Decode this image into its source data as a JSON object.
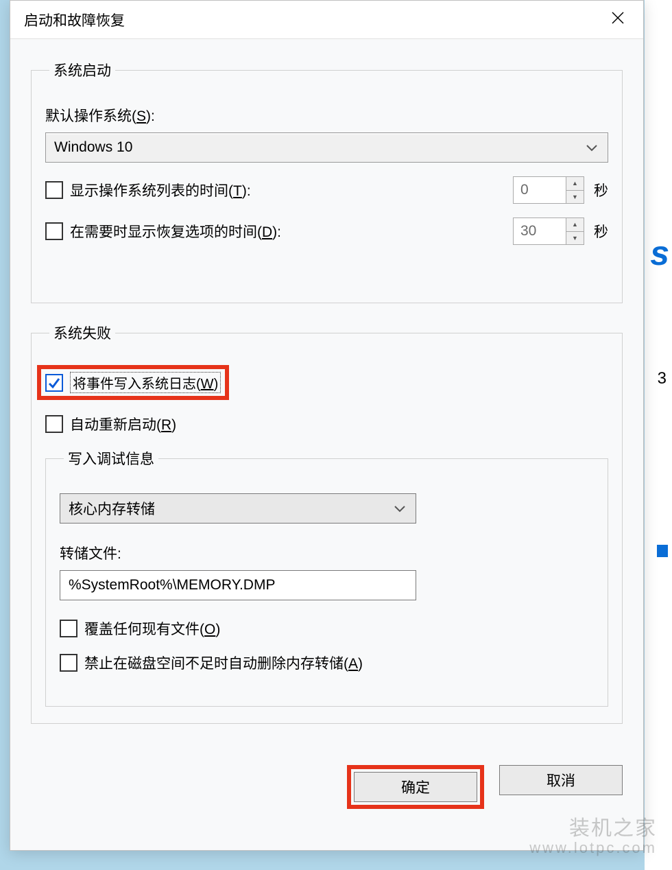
{
  "window": {
    "title": "启动和故障恢复"
  },
  "systemStartup": {
    "legend": "系统启动",
    "defaultOSLabel": "默认操作系统(",
    "defaultOSLetter": "S",
    "defaultOSLabelEnd": "):",
    "osSelected": "Windows 10",
    "showOSListLabel": "显示操作系统列表的时间(",
    "showOSListLetter": "T",
    "showOSListEnd": "):",
    "showOSListValue": "0",
    "showRecoveryLabel": "在需要时显示恢复选项的时间(",
    "showRecoveryLetter": "D",
    "showRecoveryEnd": "):",
    "showRecoveryValue": "30",
    "secondsUnit": "秒"
  },
  "systemFailure": {
    "legend": "系统失败",
    "writeEventLabel": "将事件写入系统日志(",
    "writeEventLetter": "W",
    "writeEventEnd": ")",
    "autoRestartLabel": "自动重新启动(",
    "autoRestartLetter": "R",
    "autoRestartEnd": ")",
    "debugInfo": {
      "legend": "写入调试信息",
      "dumpTypeSelected": "核心内存转储",
      "dumpFileLabel": "转储文件:",
      "dumpFileValue": "%SystemRoot%\\MEMORY.DMP",
      "overwriteLabel": "覆盖任何现有文件(",
      "overwriteLetter": "O",
      "overwriteEnd": ")",
      "disableAutoDeleteLabel": "禁止在磁盘空间不足时自动删除内存转储(",
      "disableAutoDeleteLetter": "A",
      "disableAutoDeleteEnd": ")"
    }
  },
  "buttons": {
    "ok": "确定",
    "cancel": "取消"
  },
  "watermark": {
    "top": "装机之家",
    "url": "www.lotpc.com"
  },
  "bgEdge": {
    "char": "s",
    "num": "3"
  }
}
